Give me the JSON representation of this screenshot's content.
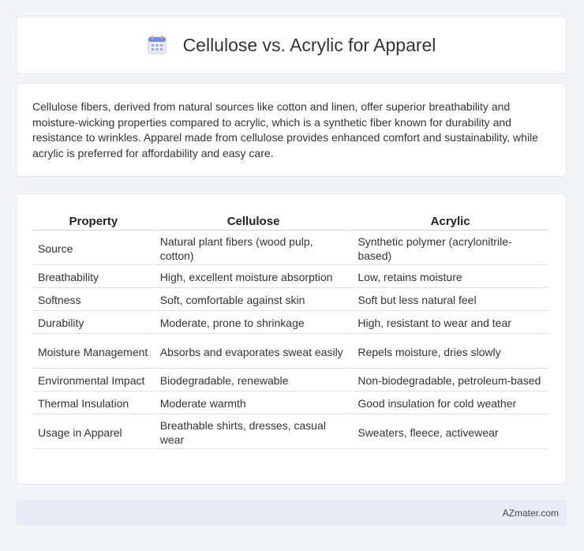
{
  "header": {
    "title": "Cellulose vs. Acrylic for Apparel",
    "icon": "calendar-icon"
  },
  "intro": {
    "text": "Cellulose fibers, derived from natural sources like cotton and linen, offer superior breathability and moisture-wicking properties compared to acrylic, which is a synthetic fiber known for durability and resistance to wrinkles. Apparel made from cellulose provides enhanced comfort and sustainability, while acrylic is preferred for affordability and easy care."
  },
  "table": {
    "headers": [
      "Property",
      "Cellulose",
      "Acrylic"
    ],
    "rows": [
      [
        "Source",
        "Natural plant fibers (wood pulp, cotton)",
        "Synthetic polymer (acrylonitrile-based)"
      ],
      [
        "Breathability",
        "High, excellent moisture absorption",
        "Low, retains moisture"
      ],
      [
        "Softness",
        "Soft, comfortable against skin",
        "Soft but less natural feel"
      ],
      [
        "Durability",
        "Moderate, prone to shrinkage",
        "High, resistant to wear and tear"
      ],
      [
        "Moisture Management",
        "Absorbs and evaporates sweat easily",
        "Repels moisture, dries slowly"
      ],
      [
        "Environmental Impact",
        "Biodegradable, renewable",
        "Non-biodegradable, petroleum-based"
      ],
      [
        "Thermal Insulation",
        "Moderate warmth",
        "Good insulation for cold weather"
      ],
      [
        "Usage in Apparel",
        "Breathable shirts, dresses, casual wear",
        "Sweaters, fleece, activewear"
      ]
    ]
  },
  "footer": {
    "text": "AZmater.com"
  }
}
